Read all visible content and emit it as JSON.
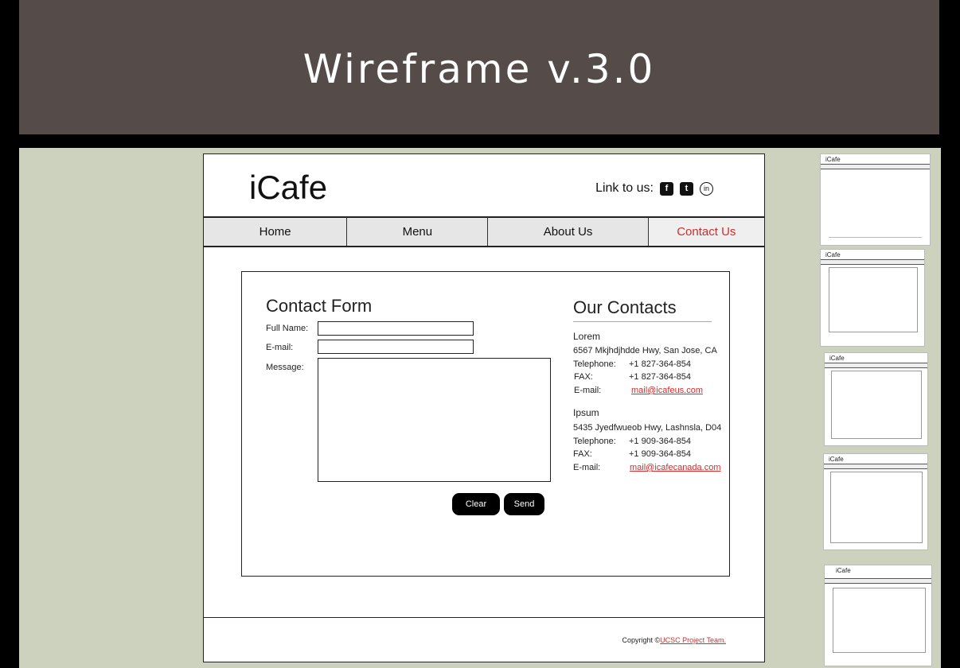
{
  "slide": {
    "title": "Wireframe v.3.0"
  },
  "site": {
    "logo": "iCafe",
    "link_label": "Link to us:",
    "social": [
      {
        "icon": "facebook-icon",
        "glyph": "f"
      },
      {
        "icon": "twitter-icon",
        "glyph": "t"
      },
      {
        "icon": "linkedin-icon",
        "glyph": "in"
      }
    ]
  },
  "nav": {
    "items": [
      "Home",
      "Menu",
      "About Us",
      "Contact Us"
    ],
    "active": "Contact Us",
    "active_color": "#d62b2b"
  },
  "form": {
    "title": "Contact Form",
    "full_name_label": "Full Name:",
    "email_label": "E-mail:",
    "message_label": "Message:",
    "clear_label": "Clear",
    "send_label": "Send"
  },
  "contacts": {
    "title": "Our Contacts",
    "offices": [
      {
        "name": "Lorem",
        "address": "6567 Mkjhdjhdde Hwy, San Jose, CA",
        "telephone_label": "Telephone:",
        "telephone": "+1 827-364-854",
        "fax_label": "FAX:",
        "fax": "+1 827-364-854",
        "email_label": "E-mail:",
        "email": "mail@icafeus.com"
      },
      {
        "name": "Ipsum",
        "address": "5435 Jyedfwueob Hwy, Lashnsla, D04",
        "telephone_label": "Telephone:",
        "telephone": "+1 909-364-854",
        "fax_label": "FAX:",
        "fax": "+1 909-364-854",
        "email_label": "E-mail:",
        "email": "mail@icafecanada.com"
      }
    ]
  },
  "footer": {
    "copyright_text": "Copyright ©",
    "copyright_link": "UCSC Project Team."
  },
  "thumbnails": {
    "logo": "iCafe"
  }
}
